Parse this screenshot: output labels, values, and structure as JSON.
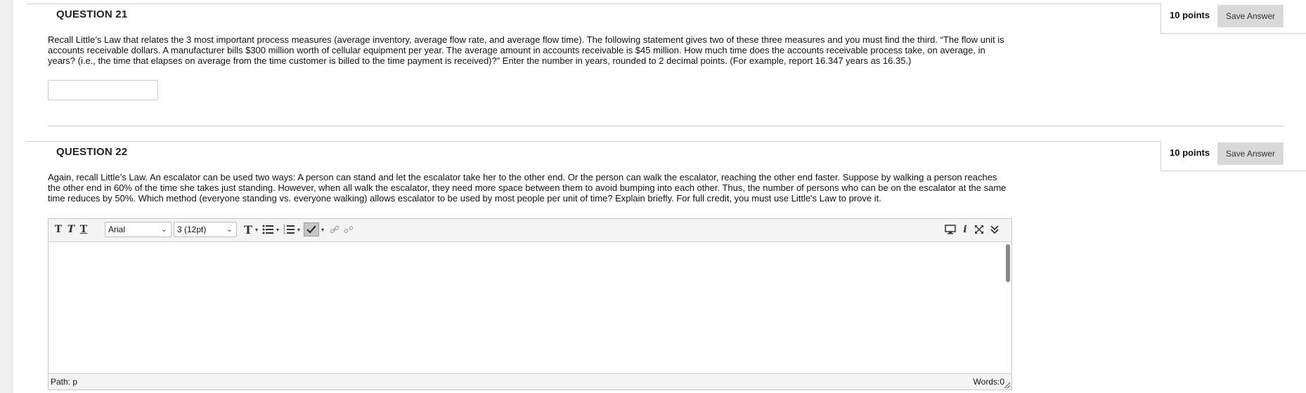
{
  "q21": {
    "title": "QUESTION 21",
    "points": "10 points",
    "save_label": "Save Answer",
    "text": "Recall Little’s Law that relates the 3 most important process measures (average inventory, average flow rate, and average flow time).  The following statement gives two of these three measures and you must find the third.  “The flow unit is accounts receivable dollars.  A manufacturer bills $300 million worth of cellular equipment per year. The average amount in accounts receivable is $45 million. How much time does the accounts receivable process take, on average, in years? (i.e., the time that elapses on average from the time customer is billed to the time payment is received)?” Enter the number in years, rounded to 2 decimal points.  (For example, report 16.347 years as 16.35.)",
    "answer_value": ""
  },
  "q22": {
    "title": "QUESTION 22",
    "points": "10 points",
    "save_label": "Save Answer",
    "text": "Again, recall Little’s Law. An escalator can be used two ways: A person can stand and let the escalator take her to the other end. Or the person can walk the escalator, reaching the other end faster. Suppose by walking a person reaches the other end in 60% of the time she takes just standing. However, when all walk the escalator, they need more space between them to avoid bumping into each other. Thus, the number of persons who can be on the escalator at the same time reduces by 50%. Which method (everyone standing vs. everyone walking) allows escalator to be used by most people per unit of time?  Explain briefly.  For full credit, you must use Little's Law to prove it."
  },
  "editor": {
    "font_family": "Arial",
    "font_size": "3 (12pt)",
    "status_path": "Path: p",
    "word_count": "Words:0",
    "toolbar_icons": [
      "bold-t-icon",
      "italic-t-icon",
      "underline-t-icon",
      "text-color-icon",
      "bullet-list-icon",
      "numbered-list-icon",
      "spellcheck-icon",
      "link-icon",
      "unlink-icon",
      "preview-icon",
      "info-icon",
      "fullscreen-icon",
      "collapse-icon"
    ]
  }
}
